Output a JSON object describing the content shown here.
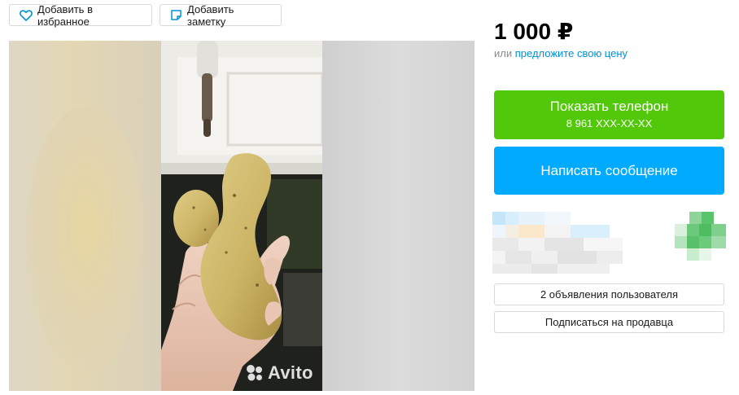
{
  "toolbar": {
    "favorite_label": "Добавить в избранное",
    "note_label": "Добавить заметку"
  },
  "listing": {
    "price": "1 000 ₽",
    "offer_prefix": "или",
    "offer_link": "предложите свою цену",
    "watermark": "Avito"
  },
  "contact": {
    "show_phone_label": "Показать телефон",
    "phone_masked": "8 961 XXX-XX-XX",
    "message_label": "Написать сообщение"
  },
  "seller": {
    "ads_button_label": "2 объявления пользователя",
    "subscribe_button_label": "Подписаться на продавца"
  },
  "colors": {
    "phone_button": "#52c80a",
    "message_button": "#00aaff",
    "link": "#0091d9"
  },
  "icons": [
    "heart-icon",
    "note-icon",
    "avito-logo-icon"
  ]
}
